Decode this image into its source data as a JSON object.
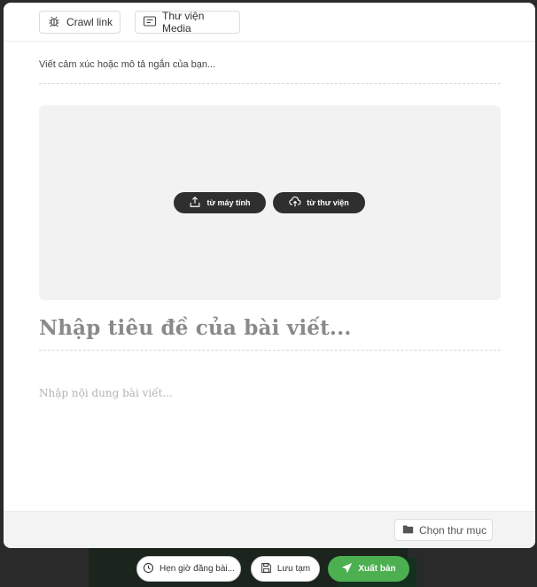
{
  "toolbar": {
    "crawl_label": "Crawl link",
    "media_label": "Thư viện Media"
  },
  "caption": {
    "placeholder": "Viết cảm xúc hoặc mô tả ngắn của bạn..."
  },
  "upload": {
    "from_computer": "từ máy tính",
    "from_library": "từ thư viện"
  },
  "post": {
    "title_placeholder": "Nhập tiêu đề của bài viết...",
    "content_placeholder": "Nhập nội dung bài viết..."
  },
  "footer": {
    "folder_label": "Chọn thư mục"
  },
  "actions": {
    "schedule_label": "Hẹn giờ đăng bài...",
    "draft_label": "Lưu tạm",
    "publish_label": "Xuất bản"
  },
  "colors": {
    "publish_green": "#4caf50",
    "upload_dark": "#2f2f2f",
    "dropzone_bg": "#f2f2f2"
  },
  "icons": {
    "crawl": "bug-icon",
    "media": "media-library-icon",
    "upload_pc": "upload-icon",
    "upload_lib": "cloud-upload-icon",
    "folder": "folder-icon",
    "schedule": "clock-icon",
    "draft": "save-icon",
    "publish": "send-icon"
  }
}
